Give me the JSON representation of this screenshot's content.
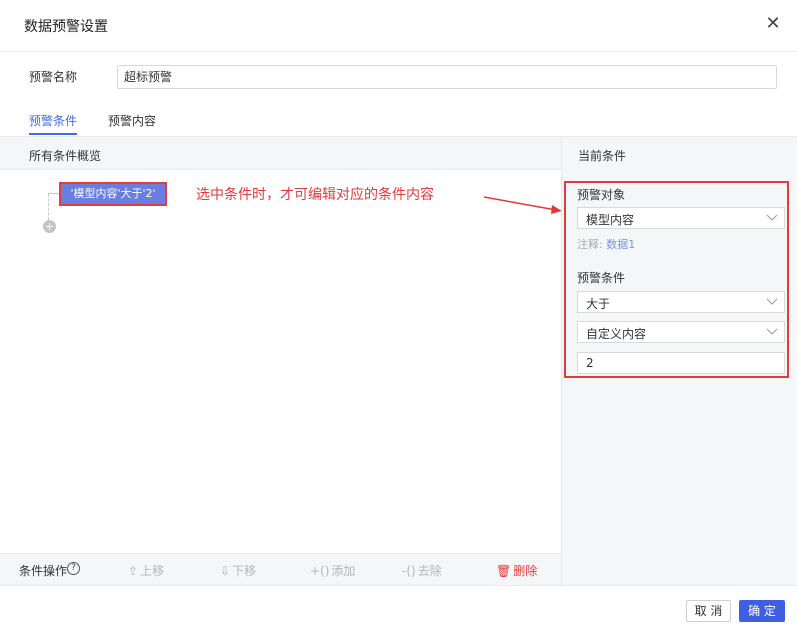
{
  "dialog": {
    "title": "数据预警设置",
    "close_icon": "close-icon"
  },
  "alert_name": {
    "label": "预警名称",
    "value": "超标预警"
  },
  "tabs": [
    {
      "label": "预警条件",
      "active": true
    },
    {
      "label": "预警内容",
      "active": false
    }
  ],
  "left_panel": {
    "header": "所有条件概览",
    "node_label": "'模型内容'大于'2'",
    "add_icon": "plus-circle-icon"
  },
  "annotation": {
    "text": "选中条件时，才可编辑对应的条件内容",
    "color": "#e03a3a"
  },
  "right_panel": {
    "header": "当前条件",
    "target_label": "预警对象",
    "target_value": "模型内容",
    "note_prefix": "注释:",
    "note_link": "数据1",
    "condition_label": "预警条件",
    "operator_value": "大于",
    "value_type": "自定义内容",
    "value": "2"
  },
  "ops": {
    "label": "条件操作",
    "help_icon": "question-circle-icon",
    "move_up": "上移",
    "move_down": "下移",
    "add_paren": "添加",
    "remove_paren": "去除",
    "delete": "删除"
  },
  "footer": {
    "cancel": "取 消",
    "ok": "确 定"
  },
  "colors": {
    "accent": "#3f6ee0",
    "node_bg": "#6a7ee0",
    "highlight": "#e23c3c",
    "primary_button": "#3f5fe0"
  }
}
